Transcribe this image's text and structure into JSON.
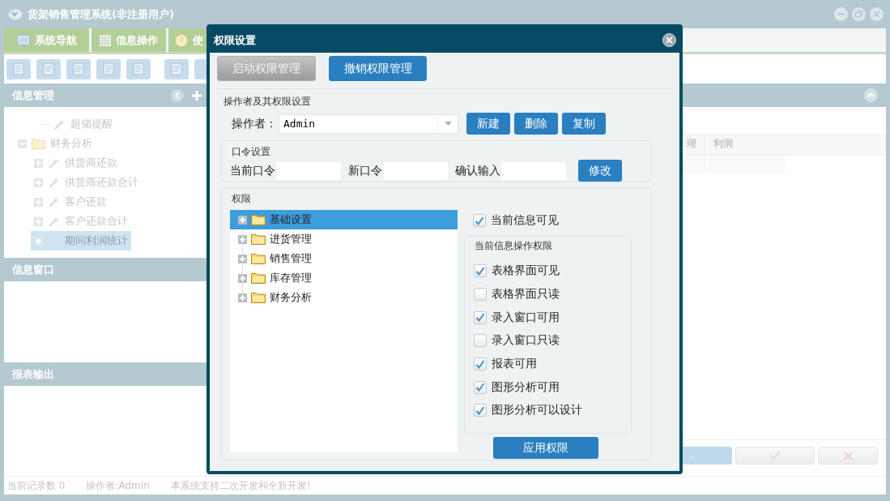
{
  "app": {
    "title": "货架销售管理系统(非注册用户)"
  },
  "tabs": [
    {
      "label": "系统导航",
      "selected": false
    },
    {
      "label": "信息操作",
      "selected": false
    },
    {
      "label": "使",
      "selected": false
    }
  ],
  "panels": [
    {
      "title": "信息管理"
    },
    {
      "title": "信息窗口"
    },
    {
      "title": "报表输出"
    }
  ],
  "nav_tree": [
    {
      "label": "超储提醒",
      "kind": "leaf",
      "selected": false
    },
    {
      "label": "财务分析",
      "kind": "folder",
      "expanded": true,
      "selected": false,
      "children": [
        {
          "label": "供货商还款",
          "kind": "leaf",
          "expanded": false,
          "selected": false
        },
        {
          "label": "供货商还款合计",
          "kind": "leaf",
          "expanded": false,
          "selected": false
        },
        {
          "label": "客户还款",
          "kind": "leaf",
          "expanded": false,
          "selected": false
        },
        {
          "label": "客户还款合计",
          "kind": "leaf",
          "expanded": false,
          "selected": false
        },
        {
          "label": "期间利润统计",
          "kind": "leaf",
          "expanded": false,
          "selected": true
        }
      ]
    }
  ],
  "grid": {
    "columns": [
      "理",
      "利润"
    ]
  },
  "status_bar": [
    "当前记录数 0",
    "操作者:Admin",
    "本系统支持二次开发和全新开发!"
  ],
  "dialog": {
    "title": "权限设置",
    "mode_buttons": [
      {
        "label": "启动权限管理",
        "disabled": true
      },
      {
        "label": "撤销权限管理",
        "disabled": false
      }
    ],
    "operator_section": {
      "legend": "操作者及其权限设置",
      "label": "操作者：",
      "value": "Admin",
      "buttons": [
        "新建",
        "删除",
        "复制"
      ]
    },
    "password_section": {
      "legend": "口令设置",
      "fields": [
        {
          "label": "当前口令"
        },
        {
          "label": "新口令"
        },
        {
          "label": "确认输入"
        }
      ],
      "button": "修改"
    },
    "permission_section": {
      "legend": "权限",
      "tree": [
        {
          "label": "基础设置",
          "expanded": false,
          "selected": true
        },
        {
          "label": "进货管理",
          "expanded": false,
          "selected": false
        },
        {
          "label": "销售管理",
          "expanded": false,
          "selected": false
        },
        {
          "label": "库存管理",
          "expanded": false,
          "selected": false
        },
        {
          "label": "财务分析",
          "expanded": false,
          "selected": false
        }
      ],
      "visible_checkbox": {
        "label": "当前信息可见",
        "checked": true
      },
      "ops_group": {
        "legend": "当前信息操作权限",
        "options": [
          {
            "label": "表格界面可见",
            "checked": true
          },
          {
            "label": "表格界面只读",
            "checked": false
          },
          {
            "label": "录入窗口可用",
            "checked": true
          },
          {
            "label": "录入窗口只读",
            "checked": false
          },
          {
            "label": "报表可用",
            "checked": true
          },
          {
            "label": "图形分析可用",
            "checked": true
          },
          {
            "label": "图形分析可以设计",
            "checked": true
          }
        ]
      },
      "apply_button": "应用权限"
    }
  }
}
